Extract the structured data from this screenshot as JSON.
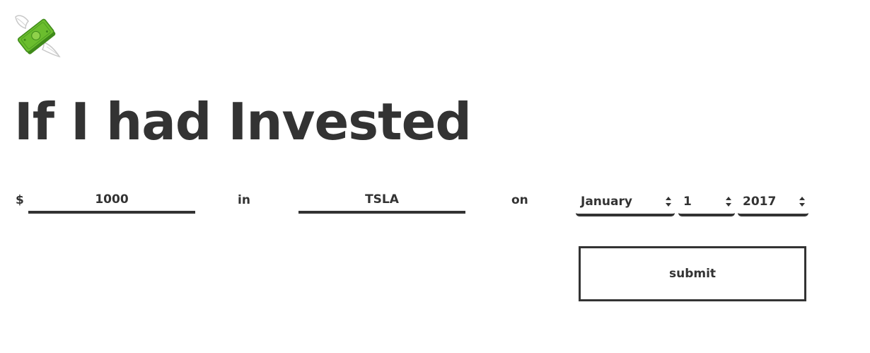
{
  "logo": {
    "icon": "money-with-wings-icon",
    "colors": {
      "bill": "#6bbd2e",
      "bill_dark": "#3f8a1a",
      "wing": "#ffffff",
      "wing_outline": "#c8c8c8"
    }
  },
  "title": "If I had Invested",
  "form": {
    "currency_symbol": "$",
    "amount_value": "1000",
    "in_label": "in",
    "ticker_value": "TSLA",
    "on_label": "on",
    "month_selected": "January",
    "day_selected": "1",
    "year_selected": "2017",
    "submit_label": "submit"
  },
  "colors": {
    "text": "#333333",
    "background": "#ffffff"
  }
}
